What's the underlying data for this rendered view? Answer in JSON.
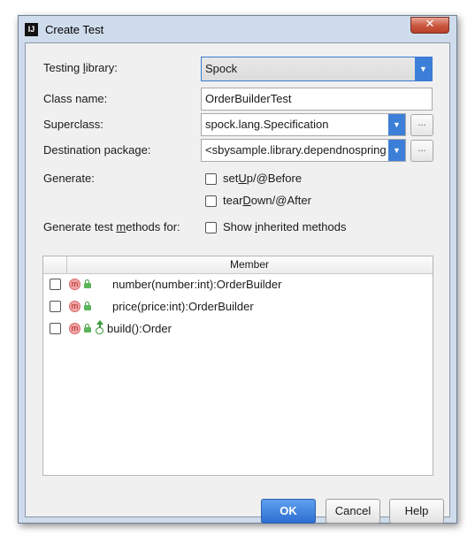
{
  "window": {
    "title": "Create Test",
    "app_icon": "IJ",
    "close_glyph": "✕"
  },
  "form": {
    "testing_library": {
      "label_pre": "Testing ",
      "label_u": "l",
      "label_post": "ibrary:",
      "value": "Spock"
    },
    "class_name": {
      "label": "Class name:",
      "value": "OrderBuilderTest"
    },
    "superclass": {
      "label": "Superclass:",
      "value": "spock.lang.Specification"
    },
    "destination_package": {
      "label": "Destination package:",
      "value": "<sbysample.library.dependnospring"
    },
    "browse_label": "...",
    "generate_label": "Generate:",
    "setup": {
      "pre": "set",
      "u": "U",
      "post": "p/@Before",
      "checked": false
    },
    "teardown": {
      "pre": "tear",
      "u": "D",
      "post": "own/@After",
      "checked": false
    },
    "methods_label": {
      "pre": "Generate test ",
      "u": "m",
      "post": "ethods for:"
    },
    "show_inherited": {
      "pre": "Show ",
      "u": "i",
      "post": "nherited methods",
      "checked": false
    }
  },
  "table": {
    "header": "Member",
    "rows": [
      {
        "text": "number(number:int):OrderBuilder",
        "badge": "m",
        "icons": [
          "method-icon",
          "lock-icon"
        ],
        "checked": false
      },
      {
        "text": "price(price:int):OrderBuilder",
        "badge": "m",
        "icons": [
          "method-icon",
          "lock-icon"
        ],
        "checked": false
      },
      {
        "text": "build():Order",
        "badge": "m",
        "icons": [
          "method-icon",
          "lock-icon",
          "override-icon"
        ],
        "checked": false
      }
    ]
  },
  "buttons": {
    "ok": "OK",
    "cancel": "Cancel",
    "help": "Help"
  },
  "colors": {
    "accent": "#3c7fd8",
    "ok_button": "#3d83e0",
    "frame": "#cfdcec",
    "dialog_bg": "#f0f0f0"
  }
}
